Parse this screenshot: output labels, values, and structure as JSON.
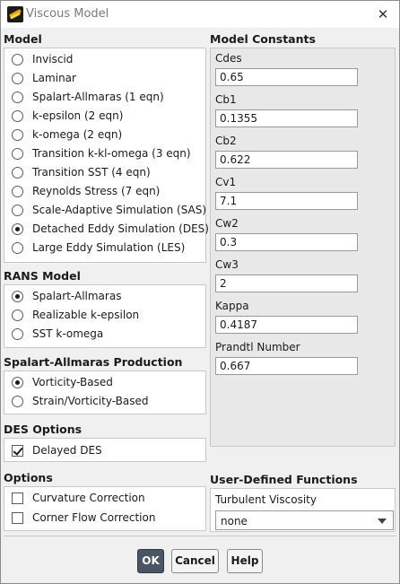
{
  "window": {
    "title": "Viscous Model",
    "close_glyph": "✕"
  },
  "model": {
    "title": "Model",
    "options": [
      {
        "label": "Inviscid",
        "selected": false
      },
      {
        "label": "Laminar",
        "selected": false
      },
      {
        "label": "Spalart-Allmaras (1 eqn)",
        "selected": false
      },
      {
        "label": "k-epsilon (2 eqn)",
        "selected": false
      },
      {
        "label": "k-omega (2 eqn)",
        "selected": false
      },
      {
        "label": "Transition k-kl-omega (3 eqn)",
        "selected": false
      },
      {
        "label": "Transition SST (4 eqn)",
        "selected": false
      },
      {
        "label": "Reynolds Stress (7 eqn)",
        "selected": false
      },
      {
        "label": "Scale-Adaptive Simulation (SAS)",
        "selected": false
      },
      {
        "label": "Detached Eddy Simulation (DES)",
        "selected": true
      },
      {
        "label": "Large Eddy Simulation (LES)",
        "selected": false
      }
    ]
  },
  "rans_model": {
    "title": "RANS Model",
    "options": [
      {
        "label": "Spalart-Allmaras",
        "selected": true
      },
      {
        "label": "Realizable k-epsilon",
        "selected": false
      },
      {
        "label": "SST k-omega",
        "selected": false
      }
    ]
  },
  "sa_production": {
    "title": "Spalart-Allmaras Production",
    "options": [
      {
        "label": "Vorticity-Based",
        "selected": true
      },
      {
        "label": "Strain/Vorticity-Based",
        "selected": false
      }
    ]
  },
  "des_options": {
    "title": "DES Options",
    "options": [
      {
        "label": "Delayed DES",
        "checked": true
      }
    ]
  },
  "options": {
    "title": "Options",
    "items": [
      {
        "label": "Curvature Correction",
        "checked": false
      },
      {
        "label": "Corner Flow Correction",
        "checked": false
      }
    ]
  },
  "model_constants": {
    "title": "Model Constants",
    "items": [
      {
        "label": "Cdes",
        "value": "0.65"
      },
      {
        "label": "Cb1",
        "value": "0.1355"
      },
      {
        "label": "Cb2",
        "value": "0.622"
      },
      {
        "label": "Cv1",
        "value": "7.1"
      },
      {
        "label": "Cw2",
        "value": "0.3"
      },
      {
        "label": "Cw3",
        "value": "2"
      },
      {
        "label": "Kappa",
        "value": "0.4187"
      },
      {
        "label": "Prandtl Number",
        "value": "0.667"
      }
    ]
  },
  "udf": {
    "title": "User-Defined Functions",
    "field_label": "Turbulent Viscosity",
    "selected": "none"
  },
  "buttons": {
    "ok": "OK",
    "cancel": "Cancel",
    "help": "Help"
  }
}
